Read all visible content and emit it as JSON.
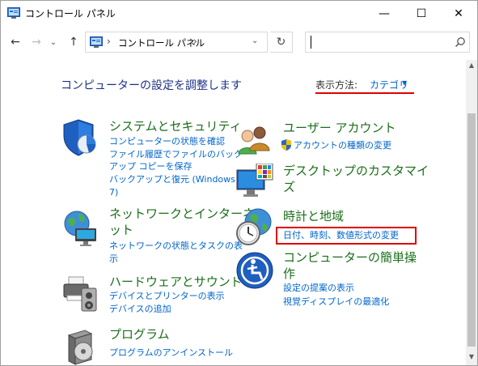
{
  "window": {
    "title": "コントロール パネル",
    "minimize_glyph": "—",
    "maximize_glyph": "☐",
    "close_glyph": "✕"
  },
  "address": {
    "back_glyph": "←",
    "forward_glyph": "→",
    "recent_glyph": "⌄",
    "up_glyph": "↑",
    "separator": "›",
    "path": "コントロール パネル",
    "dropdown_glyph": "⌄",
    "refresh_glyph": "↻",
    "search_placeholder": ""
  },
  "header": {
    "title": "コンピューターの設定を調整します",
    "view_by_label": "表示方法:",
    "view_by_value": "カテゴリ",
    "view_by_arrow": "▼"
  },
  "categories_left": [
    {
      "title": "システムとセキュリティ",
      "links": [
        "コンピューターの状態を確認",
        "ファイル履歴でファイルのバック",
        "アップ コピーを保存",
        "バックアップと復元 (Windows",
        "7)"
      ]
    },
    {
      "title_lines": [
        "ネットワークとインターネ",
        "ット"
      ],
      "links": [
        "ネットワークの状態とタスクの表",
        "示"
      ]
    },
    {
      "title": "ハードウェアとサウンド",
      "links": [
        "デバイスとプリンターの表示",
        "デバイスの追加"
      ]
    },
    {
      "title": "プログラム",
      "links": [
        "プログラムのアンインストール"
      ]
    }
  ],
  "categories_right": [
    {
      "title": "ユーザー アカウント",
      "links": [
        "アカウントの種類の変更"
      ]
    },
    {
      "title_lines": [
        "デスクトップのカスタマイ",
        "ズ"
      ],
      "links": []
    },
    {
      "title": "時計と地域",
      "links": [
        "日付、時刻、数値形式の変更"
      ]
    },
    {
      "title_lines": [
        "コンピューターの簡単操",
        "作"
      ],
      "links": [
        "設定の提案の表示",
        "視覚ディスプレイの最適化"
      ]
    }
  ],
  "scrollbar": {
    "up_glyph": "▲",
    "down_glyph": "▼"
  },
  "colors": {
    "category_title": "#1b6e1b",
    "link": "#0066cc",
    "page_title": "#1e3287",
    "highlight": "#e00000"
  }
}
